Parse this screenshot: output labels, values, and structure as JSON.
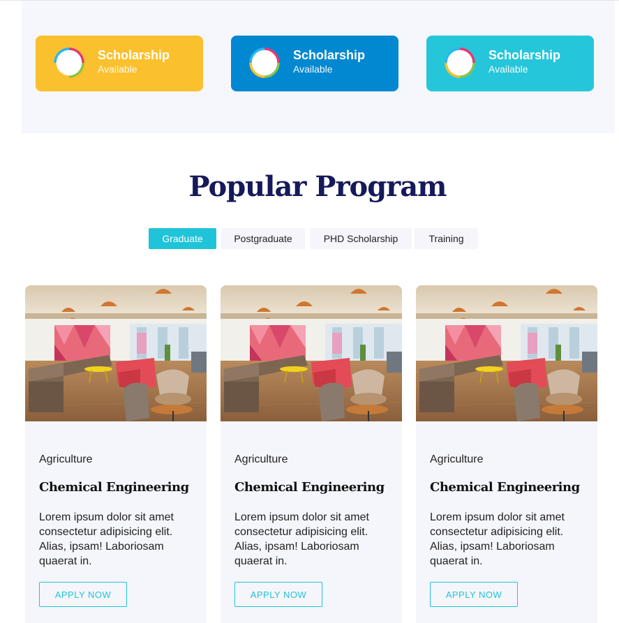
{
  "colors": {
    "yellow": "#fbc02d",
    "blue": "#0288d1",
    "cyan": "#26c6da",
    "accent": "#1fc4d8",
    "title": "#16195a"
  },
  "scholarships": [
    {
      "title": "Scholarship",
      "subtitle": "Available",
      "icon": "progress-ring-icon"
    },
    {
      "title": "Scholarship",
      "subtitle": "Available",
      "icon": "progress-ring-icon"
    },
    {
      "title": "Scholarship",
      "subtitle": "Available",
      "icon": "progress-ring-icon"
    }
  ],
  "section": {
    "title": "Popular Program"
  },
  "tabs": [
    {
      "label": "Graduate",
      "active": true
    },
    {
      "label": "Postgraduate",
      "active": false
    },
    {
      "label": "PHD Scholarship",
      "active": false
    },
    {
      "label": "Training",
      "active": false
    }
  ],
  "programs": [
    {
      "category": "Agriculture",
      "title": "Chemical Engineering",
      "description": "Lorem ipsum dolor sit amet consectetur adipisicing elit. Alias, ipsam! Laboriosam quaerat in.",
      "button": "APPLY NOW",
      "image": "office-lounge-photo"
    },
    {
      "category": "Agriculture",
      "title": "Chemical Engineering",
      "description": "Lorem ipsum dolor sit amet consectetur adipisicing elit. Alias, ipsam! Laboriosam quaerat in.",
      "button": "APPLY NOW",
      "image": "office-lounge-photo"
    },
    {
      "category": "Agriculture",
      "title": "Chemical Engineering",
      "description": "Lorem ipsum dolor sit amet consectetur adipisicing elit. Alias, ipsam! Laboriosam quaerat in.",
      "button": "APPLY NOW",
      "image": "office-lounge-photo"
    }
  ]
}
